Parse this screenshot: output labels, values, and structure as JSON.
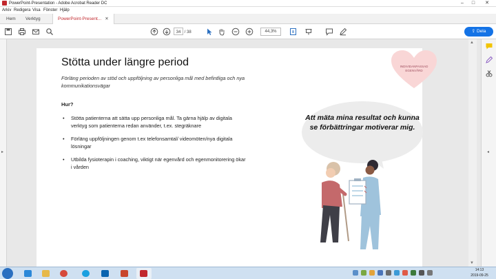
{
  "window": {
    "title": "PowerPoint-Presentation - Adobe Acrobat Reader DC",
    "controls": [
      "minimize-icon",
      "maximize-icon",
      "close-icon"
    ]
  },
  "menu": [
    "Arkiv",
    "Redigera",
    "Visa",
    "Fönster",
    "Hjälp"
  ],
  "tabs": [
    {
      "label": "Hem"
    },
    {
      "label": "Verktyg"
    },
    {
      "label": "PowerPoint-Present...",
      "active": true
    }
  ],
  "toolbar": {
    "page_current": "34",
    "page_total": "/ 38",
    "zoom": "44,3%",
    "share_label": "Dela"
  },
  "slide": {
    "title": "Stötta under längre period",
    "subtitle": "Förläng perioden av stöd och uppföljning av personliga mål med befintliga och nya kommunikationsvägar",
    "hur_label": "Hur?",
    "bullets": [
      "Stötta patienterna att sätta upp personliga mål. Ta gärna hjälp av digitala verktyg som patienterna redan använder, t.ex. stegräknare",
      "Förläng uppföljningen genom t.ex telefonsamtal/ videomöten/nya digitala lösningar",
      "Utbilda fysioterapin i coaching, viktigt när egenvård och egenmonitorering ökar i vården"
    ],
    "heart_text": "INDIVIDANPASSAD EGENVÅRD",
    "speech_bubble": "Att mäta mina resultat och kunna se förbättringar motiverar mig."
  },
  "taskbar": {
    "time": "14:13",
    "date": "2019-09-25"
  },
  "colors": {
    "accent_red": "#c1272d",
    "share_blue": "#1473e6",
    "heart_pink": "#f9d6d6",
    "bubble_grey": "#ececec",
    "taskbar_blue": "#cfe0f1"
  }
}
